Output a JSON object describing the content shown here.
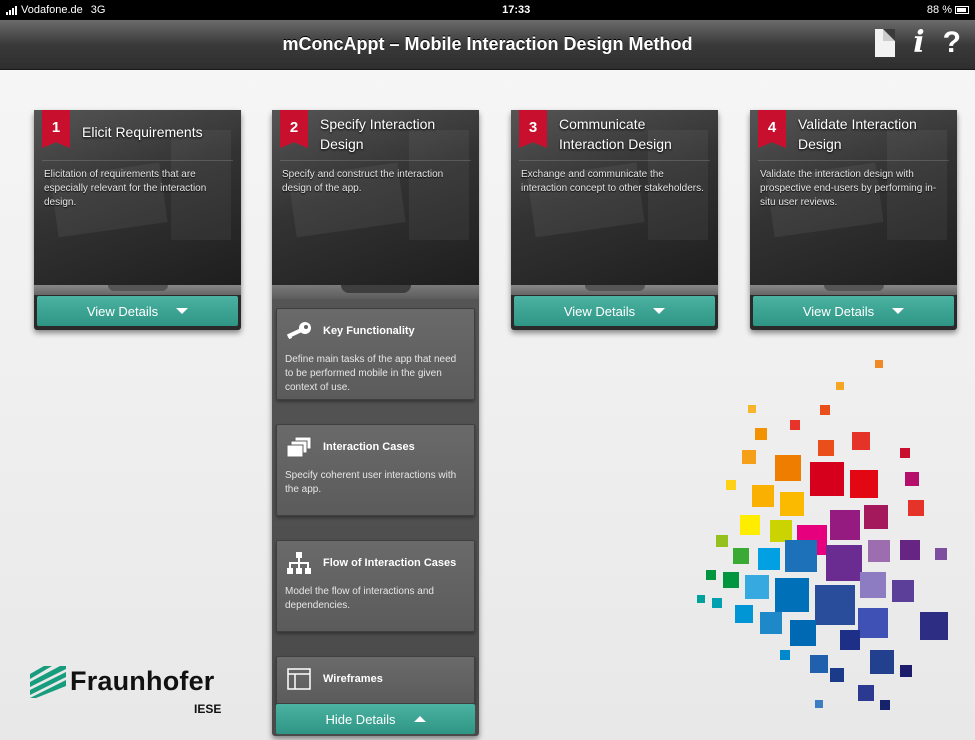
{
  "status_bar": {
    "carrier": "Vodafone.de",
    "network": "3G",
    "time": "17:33",
    "battery": "88 %"
  },
  "nav": {
    "title": "mConcAppt – Mobile Interaction Design Method",
    "icons": [
      "document-icon",
      "info-icon",
      "help-icon"
    ],
    "info_glyph": "i",
    "help_glyph": "?"
  },
  "colors": {
    "badge": "#c8102e",
    "button_teal": "#3aa494",
    "nav_dark": "#3a3a3a"
  },
  "steps": [
    {
      "number": "1",
      "title": "Elicit Requirements",
      "description": "Elicitation of requirements that are especially relevant for the interaction design.",
      "button": "View Details"
    },
    {
      "number": "2",
      "title": "Specify Interaction Design",
      "description": "Specify and construct the interaction design of the app.",
      "button": "Hide Details",
      "sub_items": [
        {
          "title": "Key Functionality",
          "icon": "key-icon",
          "description": "Define main tasks of the app that need to be performed mobile in the given context of use."
        },
        {
          "title": "Interaction Cases",
          "icon": "stacked-cards-icon",
          "description": "Specify coherent user interactions with the app."
        },
        {
          "title": "Flow of Interaction Cases",
          "icon": "flow-chart-icon",
          "description": "Model the flow of interactions and dependencies."
        },
        {
          "title": "Wireframes",
          "icon": "wireframe-icon",
          "description": ""
        }
      ]
    },
    {
      "number": "3",
      "title": "Communicate Interaction Design",
      "description": "Exchange and communicate the interaction concept to other stakeholders.",
      "button": "View Details"
    },
    {
      "number": "4",
      "title": "Validate Interaction Design",
      "description": "Validate the interaction design with prospective end-users by performing in-situ user reviews.",
      "button": "View Details"
    }
  ],
  "logo": {
    "brand": "Fraunhofer",
    "unit": "IESE"
  }
}
